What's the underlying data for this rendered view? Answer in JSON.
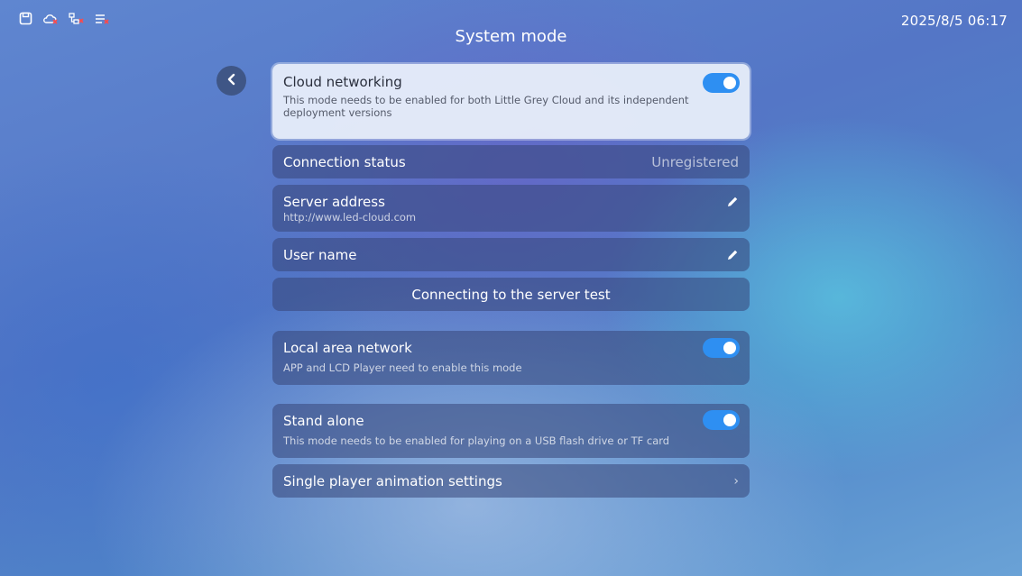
{
  "status_bar": {
    "icons": [
      "save-icon",
      "cloud-error-icon",
      "network-error-icon",
      "list-error-icon"
    ],
    "datetime": "2025/8/5 06:17"
  },
  "header": {
    "title": "System mode"
  },
  "cloud_networking": {
    "title": "Cloud networking",
    "description": "This mode needs to be enabled for both Little Grey Cloud and its independent deployment versions",
    "enabled": true
  },
  "connection_status": {
    "label": "Connection status",
    "value": "Unregistered"
  },
  "server_address": {
    "label": "Server address",
    "value": "http://www.led-cloud.com"
  },
  "user_name": {
    "label": "User name"
  },
  "test_button": {
    "label": "Connecting to the server test"
  },
  "local_area_network": {
    "title": "Local area network",
    "description": "APP and LCD Player need to enable this mode",
    "enabled": true
  },
  "stand_alone": {
    "title": "Stand alone",
    "description": "This mode needs to be enabled for playing on a USB flash drive or TF card",
    "enabled": true
  },
  "animation_settings": {
    "label": "Single player animation settings"
  },
  "colors": {
    "toggle_on": "#2e8ff2",
    "card_dark": "#37467a",
    "card_highlight": "#e8eefa"
  }
}
